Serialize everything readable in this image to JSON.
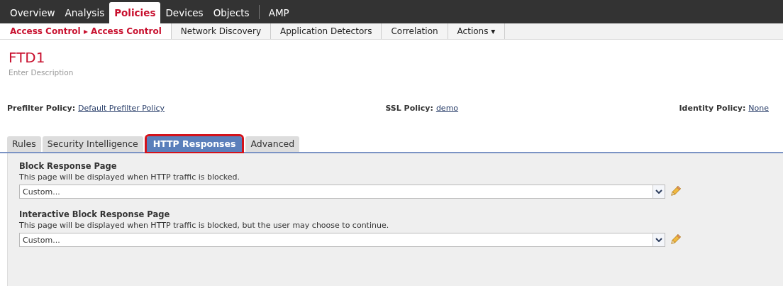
{
  "top_nav": [
    {
      "label": "Overview",
      "selected": false
    },
    {
      "label": "Analysis",
      "selected": false
    },
    {
      "label": "Policies",
      "selected": true
    },
    {
      "label": "Devices",
      "selected": false
    },
    {
      "label": "Objects",
      "selected": false
    }
  ],
  "top_nav_extra": [
    {
      "label": "AMP",
      "selected": false
    }
  ],
  "sub_nav": [
    {
      "label": "Access Control ▸ Access Control",
      "selected": true
    },
    {
      "label": "Network Discovery",
      "selected": false
    },
    {
      "label": "Application Detectors",
      "selected": false
    },
    {
      "label": "Correlation",
      "selected": false
    },
    {
      "label": "Actions ▾",
      "selected": false
    }
  ],
  "policy": {
    "title": "FTD1",
    "description": "Enter Description"
  },
  "policy_links": [
    {
      "label": "Prefilter Policy:",
      "value": "Default Prefilter Policy"
    },
    {
      "label": "SSL Policy:",
      "value": "demo"
    },
    {
      "label": "Identity Policy:",
      "value": "None"
    }
  ],
  "tabs": [
    {
      "label": "Rules",
      "selected": false
    },
    {
      "label": "Security Intelligence",
      "selected": false
    },
    {
      "label": "HTTP Responses",
      "selected": true
    },
    {
      "label": "Advanced",
      "selected": false
    }
  ],
  "sections": [
    {
      "title": "Block Response Page",
      "description": "This page will be displayed when HTTP traffic is blocked.",
      "value": "Custom..."
    },
    {
      "title": "Interactive Block Response Page",
      "description": "This page will be displayed when HTTP traffic is blocked, but the user may choose to continue.",
      "value": "Custom..."
    }
  ]
}
